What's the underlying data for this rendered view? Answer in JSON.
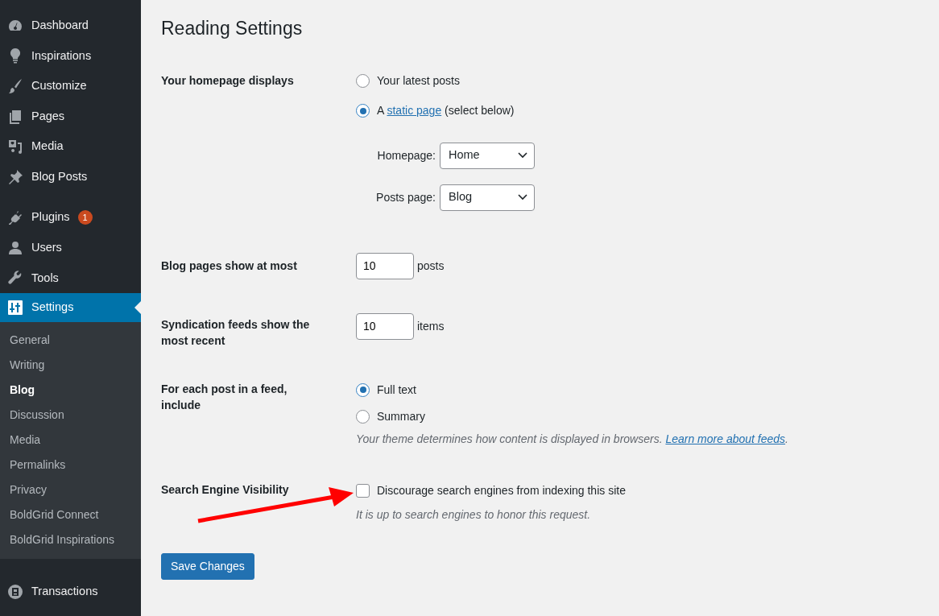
{
  "sidebar": {
    "groups": [
      [
        {
          "label": "Dashboard",
          "selected": false
        },
        {
          "label": "Inspirations",
          "selected": false
        },
        {
          "label": "Customize",
          "selected": false
        },
        {
          "label": "Pages",
          "selected": false
        },
        {
          "label": "Media",
          "selected": false
        },
        {
          "label": "Blog Posts",
          "selected": false
        }
      ],
      [
        {
          "label": "Plugins",
          "selected": false,
          "badge": "1"
        },
        {
          "label": "Users",
          "selected": false
        },
        {
          "label": "Tools",
          "selected": false
        },
        {
          "label": "Settings",
          "selected": true,
          "children": [
            {
              "label": "General",
              "selected": false
            },
            {
              "label": "Writing",
              "selected": false
            },
            {
              "label": "Blog",
              "selected": true
            },
            {
              "label": "Discussion",
              "selected": false
            },
            {
              "label": "Media",
              "selected": false
            },
            {
              "label": "Permalinks",
              "selected": false
            },
            {
              "label": "Privacy",
              "selected": false
            },
            {
              "label": "BoldGrid Connect",
              "selected": false
            },
            {
              "label": "BoldGrid Inspirations",
              "selected": false
            }
          ]
        }
      ],
      [
        {
          "label": "Transactions",
          "selected": false
        }
      ]
    ]
  },
  "title": "Reading Settings",
  "rows": [
    {
      "kind": "radio",
      "label": "Your homepage displays",
      "options": [
        {
          "label": "Your latest posts",
          "selected": false
        },
        {
          "label": "A",
          "link": "static page",
          "after": "(select below)",
          "selected": true
        }
      ],
      "selects": [
        {
          "label": "Homepage:",
          "value": "Home"
        },
        {
          "label": "Posts page:",
          "value": "Blog"
        }
      ]
    },
    {
      "kind": "number",
      "label": "Blog pages show at most",
      "value": "10",
      "unit": "posts"
    },
    {
      "kind": "number",
      "label": "Syndication feeds show the most recent",
      "value": "10",
      "unit": "items"
    },
    {
      "kind": "radio",
      "label": "For each post in a feed, include",
      "options": [
        {
          "label": "Full text",
          "selected": true
        },
        {
          "label": "Summary",
          "selected": false
        }
      ],
      "description": {
        "text": "Your theme determines how content is displayed in browsers.",
        "link": "Learn more about feeds",
        "after": "."
      }
    },
    {
      "kind": "checkbox",
      "label": "Search Engine Visibility",
      "option": {
        "label": "Discourage search engines from indexing this site",
        "checked": false
      },
      "description": {
        "text": "It is up to search engines to honor this request."
      }
    }
  ],
  "save_button": "Save Changes",
  "annotation": {
    "kind": "arrow"
  }
}
